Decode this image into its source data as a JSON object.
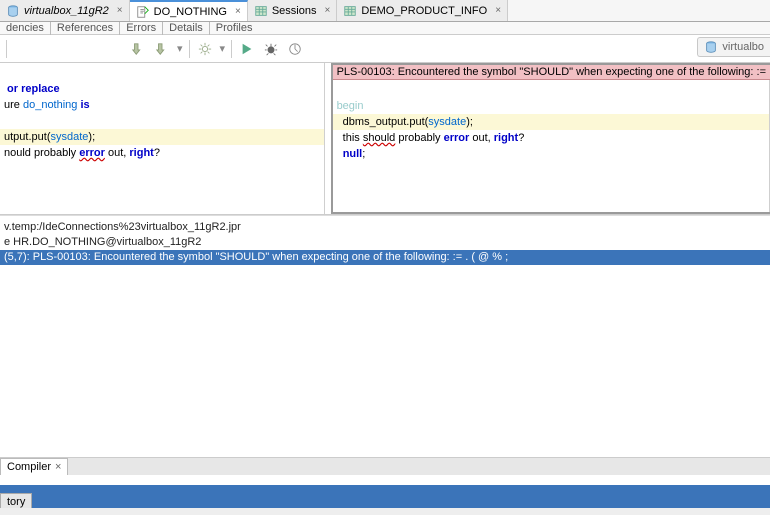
{
  "tabs": [
    {
      "label": "virtualbox_11gR2",
      "icon": "db-icon"
    },
    {
      "label": "DO_NOTHING",
      "icon": "proc-icon",
      "active": true
    },
    {
      "label": "Sessions",
      "icon": "table-icon"
    },
    {
      "label": "DEMO_PRODUCT_INFO",
      "icon": "table-icon"
    }
  ],
  "subtabs": [
    "dencies",
    "References",
    "Errors",
    "Details",
    "Profiles"
  ],
  "toolbar": {
    "db_label": "virtualbo"
  },
  "editor": {
    "left": {
      "l1a": " or replace",
      "l2a": "ure ",
      "l2b": "do_nothing",
      "l2c": " is",
      "l3a": "utput.put(",
      "l3b": "sysdate",
      "l3c": ");",
      "l4a": "nould probably ",
      "l4b": "error",
      "l4c": " out, ",
      "l4d": "right",
      "l4e": "?"
    },
    "right": {
      "banner": "PLS-00103: Encountered the symbol \"SHOULD\" when expecting one of the following:   :=",
      "l0": "begin",
      "l1a": "  dbms_output.put(",
      "l1b": "sysdate",
      "l1c": ");",
      "l2a": "  this ",
      "l2b": "should",
      "l2c": " probably ",
      "l2d": "error",
      "l2e": " out, ",
      "l2f": "right",
      "l2g": "?",
      "l3a": "  ",
      "l3b": "null",
      "l3c": ";"
    }
  },
  "messages": {
    "m1": "v.temp:/IdeConnections%23virtualbox_11gR2.jpr",
    "m2": "e HR.DO_NOTHING@virtualbox_11gR2",
    "m3": "(5,7): PLS-00103: Encountered the symbol \"SHOULD\" when expecting one of the following:     := . ( @ % ;"
  },
  "compilerTab": "Compiler",
  "historyTab": "tory"
}
